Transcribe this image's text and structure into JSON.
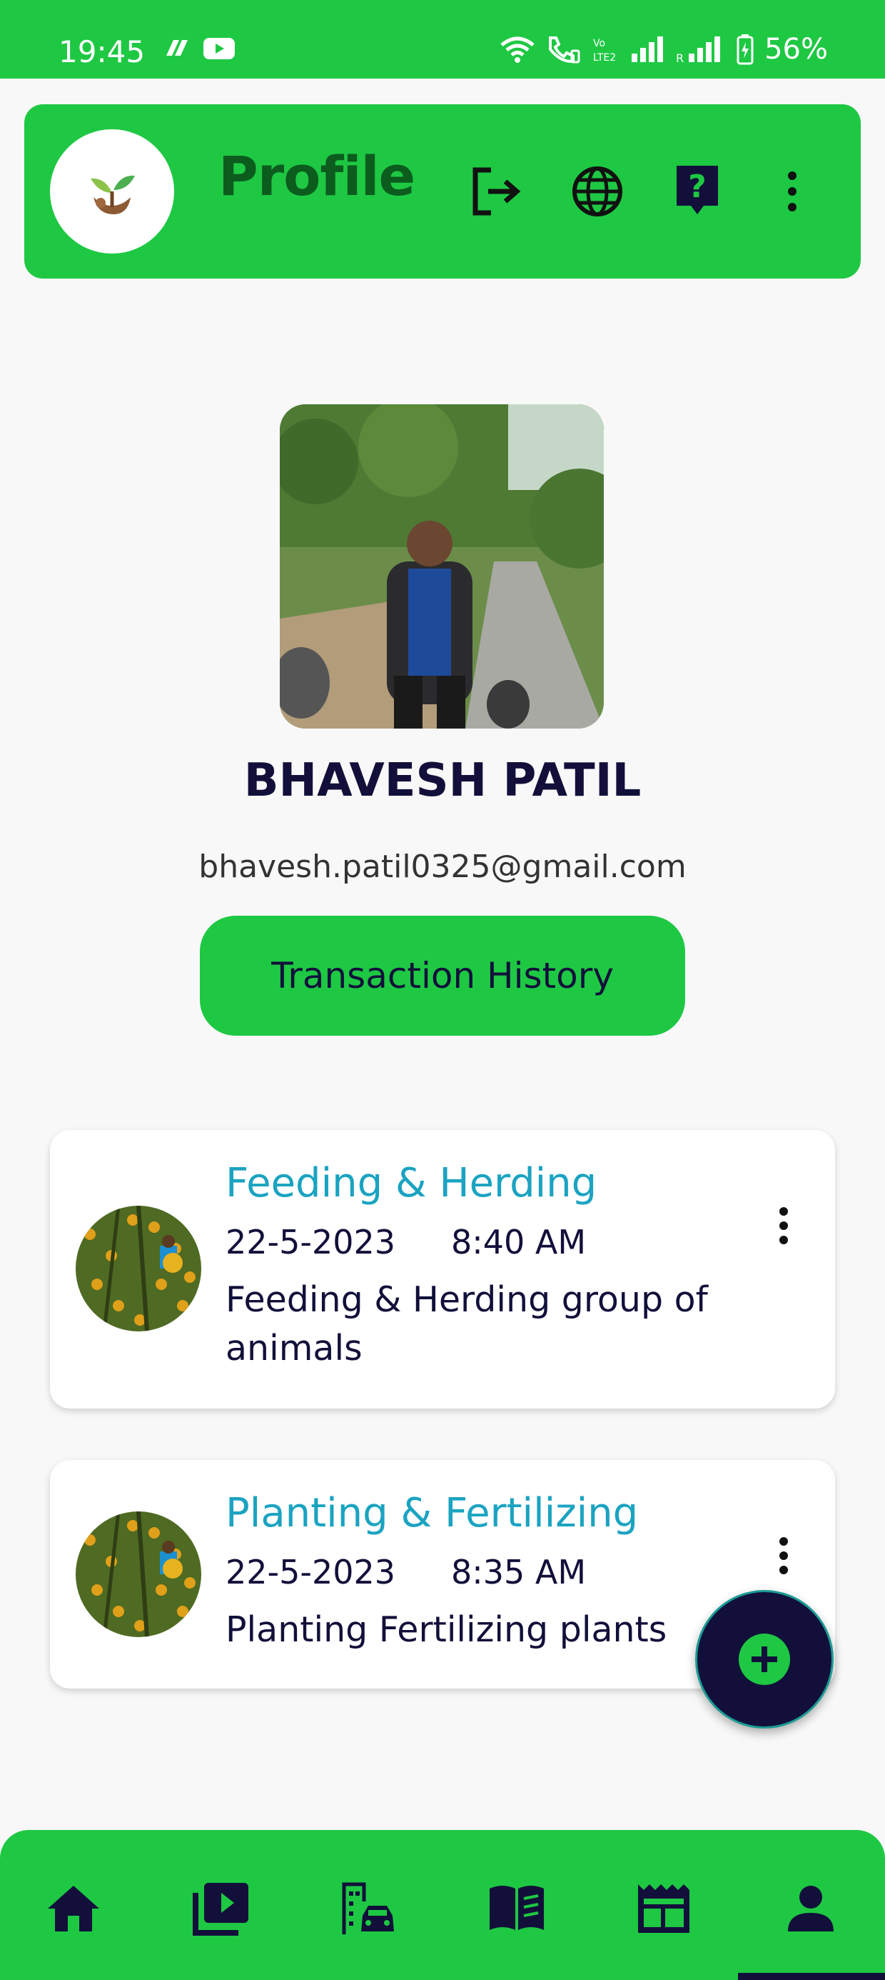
{
  "status_bar": {
    "time": "19:45",
    "battery": "56%",
    "icons": [
      "app-notification-icon",
      "youtube-icon",
      "wifi-icon",
      "wifi-calling-icon",
      "volte-icon",
      "signal-icon",
      "roaming-signal-icon",
      "battery-icon"
    ]
  },
  "app_bar": {
    "title": "Profile",
    "actions": [
      "logout-icon",
      "language-icon",
      "help-icon",
      "more-vert-icon"
    ]
  },
  "profile": {
    "name": "BHAVESH PATIL",
    "email": "bhavesh.patil0325@gmail.com",
    "transaction_button": "Transaction History"
  },
  "activities": [
    {
      "title": "Feeding & Herding",
      "date": "22-5-2023",
      "time": "8:40 AM",
      "description": "Feeding & Herding group of animals"
    },
    {
      "title": "Planting & Fertilizing",
      "date": "22-5-2023",
      "time": "8:35 AM",
      "description": "Planting Fertilizing plants"
    }
  ],
  "bottom_nav": {
    "items": [
      "home-icon",
      "videos-icon",
      "city-transport-icon",
      "book-icon",
      "news-icon",
      "profile-icon"
    ],
    "selected": "profile-icon"
  },
  "colors": {
    "brand_green": "#1ec843",
    "dark_navy": "#12103a",
    "title_teal": "#1ba3c1",
    "title_dark_green": "#0c5c1e"
  }
}
